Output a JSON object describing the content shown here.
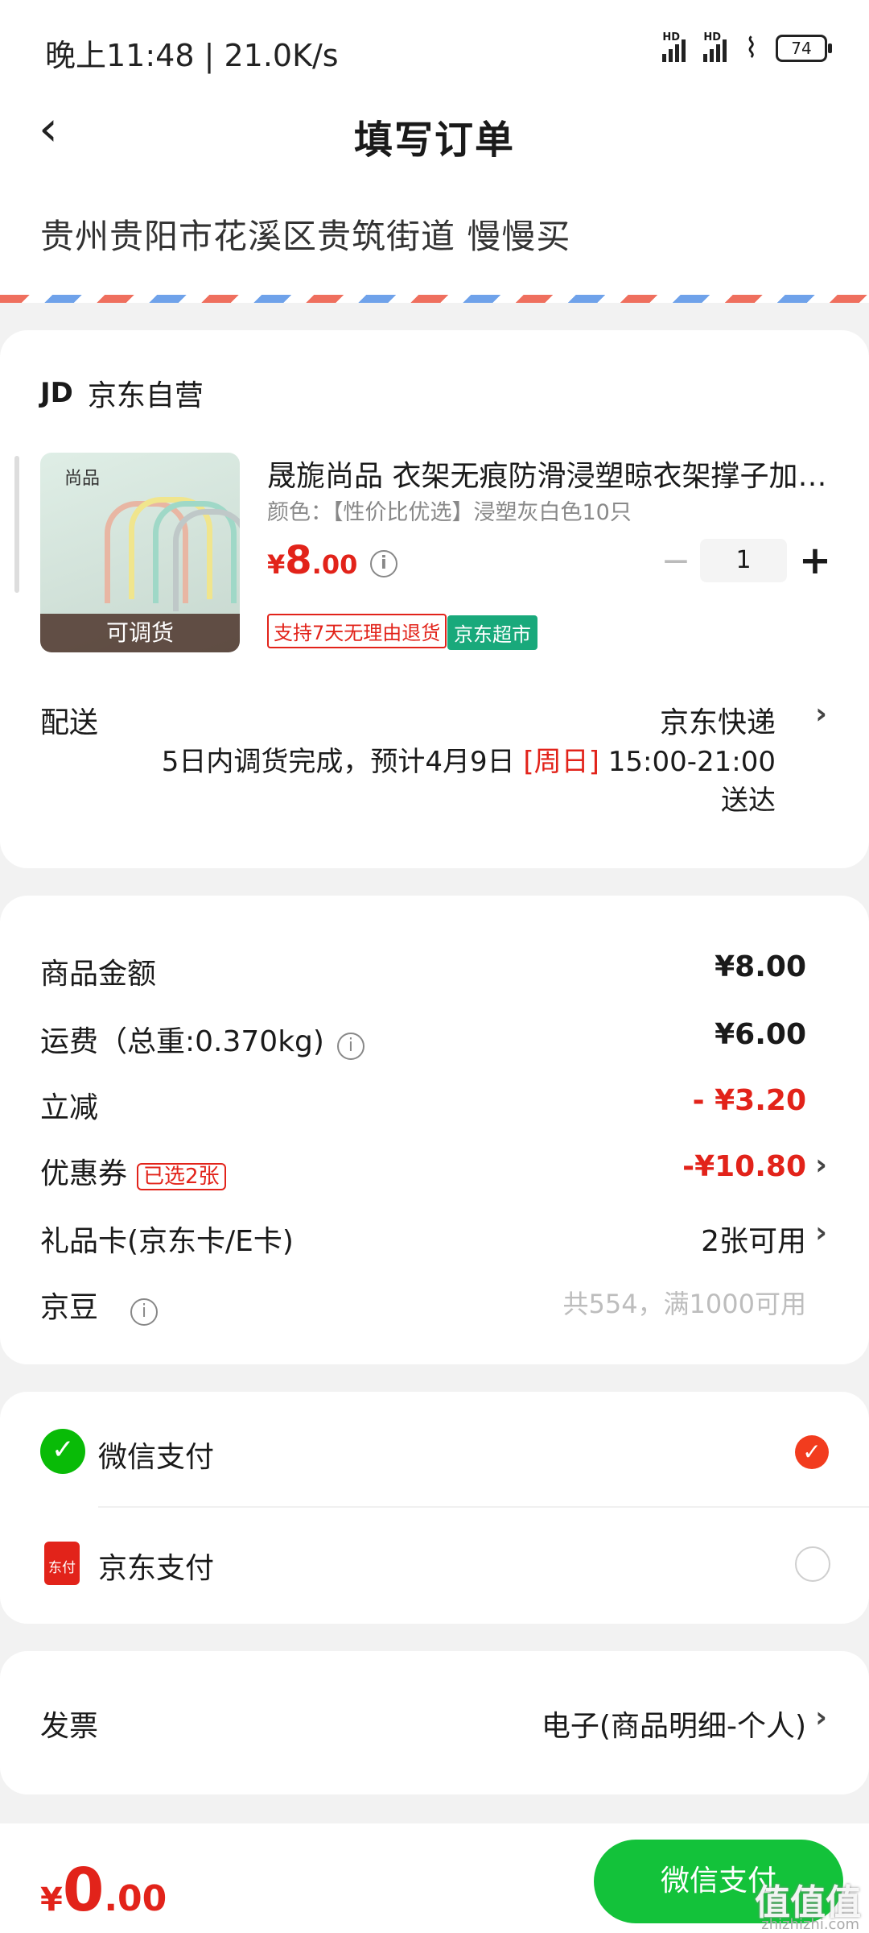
{
  "status_bar": {
    "time": "晚上11:48 | 21.0K/s",
    "battery": "74",
    "hd1": "HD",
    "hd2": "HD"
  },
  "header": {
    "title": "填写订单"
  },
  "address": {
    "text": "贵州贵阳市花溪区贵筑街道 慢慢买"
  },
  "store": {
    "logo": "JD",
    "name": "京东自营"
  },
  "product": {
    "thumb_brand": "尚品",
    "thumb_label": "可调货",
    "name": "晟旎尚品 衣架无痕防滑浸塑晾衣架撑子加…",
    "color": "颜色：【性价比优选】浸塑灰白色10只",
    "price_currency": "¥",
    "price_int": "8",
    "price_dec": ".00",
    "quantity": "1",
    "tag_return": "支持7天无理由退货",
    "tag_market": "京东超市"
  },
  "delivery": {
    "label": "配送",
    "method": "京东快递",
    "line1_a": "5日内调货完成，预计4月9日 ",
    "line1_day": "[周日]",
    "line1_b": " 15:00-21:00",
    "line2": "送达"
  },
  "summary": [
    {
      "label": "商品金额",
      "value": "¥8.00"
    },
    {
      "label": "运费（总重:0.370kg)",
      "value": "¥6.00"
    },
    {
      "label": "立减",
      "value": "- ¥3.20"
    },
    {
      "label": "优惠券",
      "tag": "已选2张",
      "value": "-¥10.80"
    },
    {
      "label": "礼品卡(京东卡/E卡)",
      "value": "2张可用"
    },
    {
      "label": "京豆",
      "value": "共554，满1000可用"
    }
  ],
  "payment": {
    "wechat": "微信支付",
    "jd": "京东支付",
    "jd_icon_text": "东付"
  },
  "invoice": {
    "label": "发票",
    "value": "电子(商品明细-个人)"
  },
  "bottom": {
    "currency": "¥",
    "total_int": "0",
    "total_dec": ".00",
    "pay_button": "微信支付"
  },
  "watermark": {
    "text": "值值值",
    "site": "zhizhizhi.com"
  },
  "colors": {
    "accent_red": "#e2231a",
    "wechat_green": "#13c23a"
  }
}
